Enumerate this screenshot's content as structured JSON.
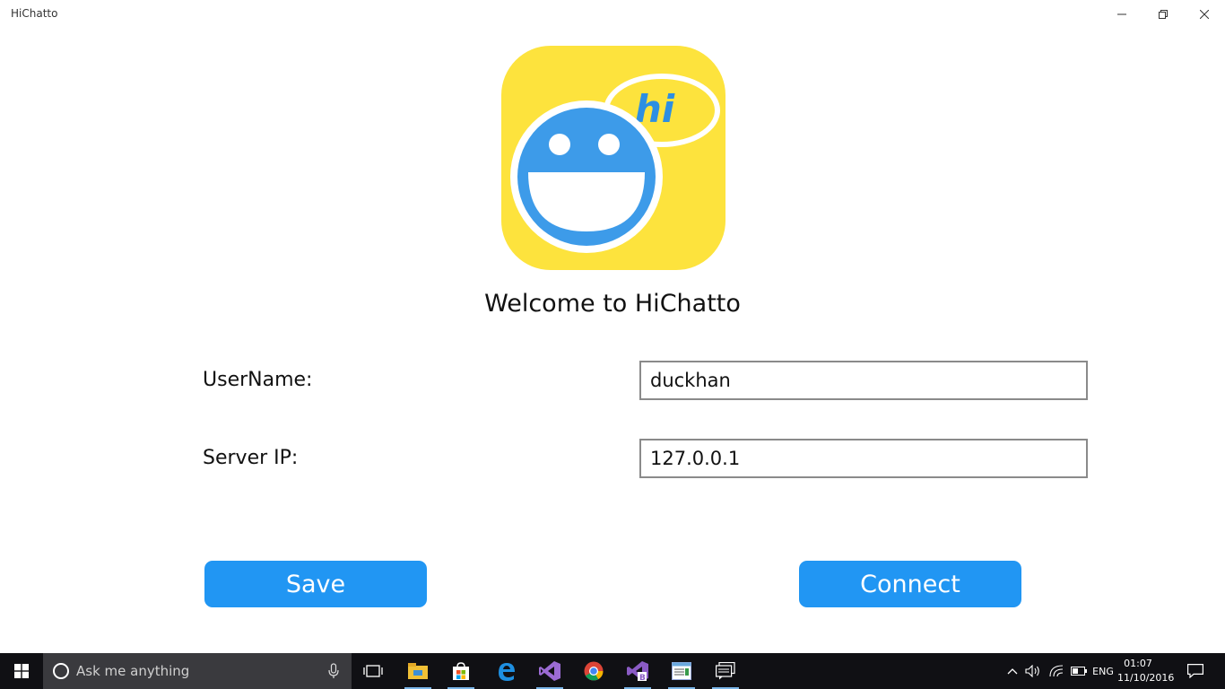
{
  "window": {
    "title": "HiChatto"
  },
  "logo": {
    "bubble_text": "hi",
    "colors": {
      "background": "#fde33d",
      "face": "#3d9be9",
      "bubble": "#fde33d"
    }
  },
  "form": {
    "welcome": "Welcome to HiChatto",
    "username_label": "UserName:",
    "username_value": "duckhan",
    "server_ip_label": "Server IP:",
    "server_ip_value": "127.0.0.1",
    "save_label": "Save",
    "connect_label": "Connect",
    "accent_color": "#2196f3"
  },
  "taskbar": {
    "search_placeholder": "Ask me anything",
    "apps": [
      "task-view-icon",
      "file-explorer-icon",
      "store-icon",
      "edge-icon",
      "visual-studio-icon",
      "chrome-icon",
      "blend-icon",
      "notepad-icon",
      "chat-app-icon"
    ],
    "language": "ENG",
    "time": "01:07",
    "date": "11/10/2016"
  }
}
